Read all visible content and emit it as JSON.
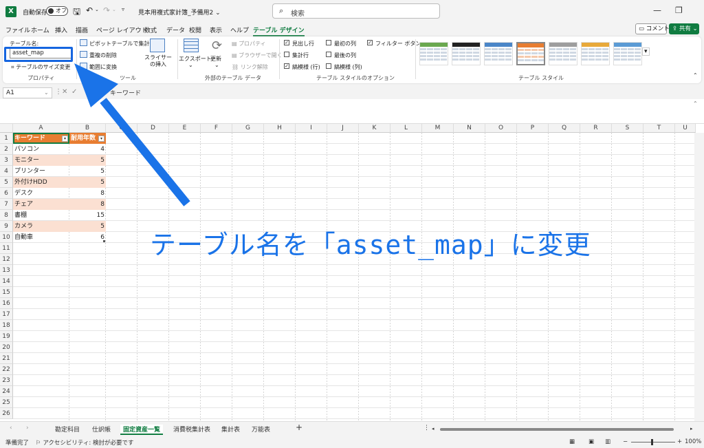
{
  "app": {
    "autosave_label": "自動保存",
    "autosave_state": "オフ",
    "file_title": "見本用複式家計簿_予備用2",
    "search_placeholder": "検索"
  },
  "menu": [
    "ファイル",
    "ホーム",
    "挿入",
    "描画",
    "ページ レイアウト",
    "数式",
    "データ",
    "校閲",
    "表示",
    "ヘルプ",
    "テーブル デザイン"
  ],
  "menu_active": "テーブル デザイン",
  "comment_button": "コメント",
  "share_button": "共有",
  "ribbon": {
    "table_name_label": "テーブル名:",
    "table_name_value": "asset_map",
    "resize_table": "テーブルのサイズ変更",
    "group_properties": "プロパティ",
    "pivot_summarize": "ピボットテーブルで集計",
    "remove_duplicates": "重複の削除",
    "convert_to_range": "範囲に変換",
    "insert_slicer": "スライサーの挿入",
    "group_tools": "ツール",
    "export": "エクスポート",
    "refresh": "更新",
    "properties": "プロパティ",
    "open_in_browser": "ブラウザーで開く",
    "unlink": "リンク解除",
    "group_external": "外部のテーブル データ",
    "opt_header_row": "見出し行",
    "opt_total_row": "集計行",
    "opt_banded_rows": "縞模様 (行)",
    "opt_first_column": "最初の列",
    "opt_last_column": "最後の列",
    "opt_banded_columns": "縞模様 (列)",
    "opt_filter_button": "フィルター ボタン",
    "group_style_options": "テーブル スタイルのオプション",
    "group_table_styles": "テーブル スタイル"
  },
  "style_colors": [
    "#6aa84f",
    "#222222",
    "#4a86c8",
    "#e87d31",
    "#9e9e9e",
    "#e8a93a",
    "#5b9bd5"
  ],
  "formula_bar": {
    "name_box": "A1",
    "content": "キーワード"
  },
  "columns": [
    "A",
    "B",
    "C",
    "D",
    "E",
    "F",
    "G",
    "H",
    "I",
    "J",
    "K",
    "L",
    "M",
    "N",
    "O",
    "P",
    "Q",
    "R",
    "S",
    "T",
    "U"
  ],
  "rows": [
    "1",
    "2",
    "3",
    "4",
    "5",
    "6",
    "7",
    "8",
    "9",
    "10",
    "11",
    "12",
    "13",
    "14",
    "15",
    "16",
    "17",
    "18",
    "19",
    "20",
    "21",
    "22",
    "23",
    "24",
    "25",
    "26"
  ],
  "table": {
    "headers": [
      "キーワード",
      "耐用年数"
    ],
    "rows": [
      [
        "パソコン",
        "4"
      ],
      [
        "モニター",
        "5"
      ],
      [
        "プリンター",
        "5"
      ],
      [
        "外付けHDD",
        "5"
      ],
      [
        "デスク",
        "8"
      ],
      [
        "チェア",
        "8"
      ],
      [
        "書棚",
        "15"
      ],
      [
        "カメラ",
        "5"
      ],
      [
        "自動車",
        "6"
      ]
    ]
  },
  "annotation": "テーブル名を「asset_map」に変更",
  "sheet_tabs": [
    "勘定科目",
    "仕訳帳",
    "固定資産一覧",
    "消費税集計表",
    "集計表",
    "万能表"
  ],
  "active_sheet": "固定資産一覧",
  "status": {
    "ready": "準備完了",
    "accessibility": "アクセシビリティ: 検討が必要です",
    "zoom": "100%"
  },
  "accent": "#107c41",
  "annotation_color": "#1a73e8"
}
